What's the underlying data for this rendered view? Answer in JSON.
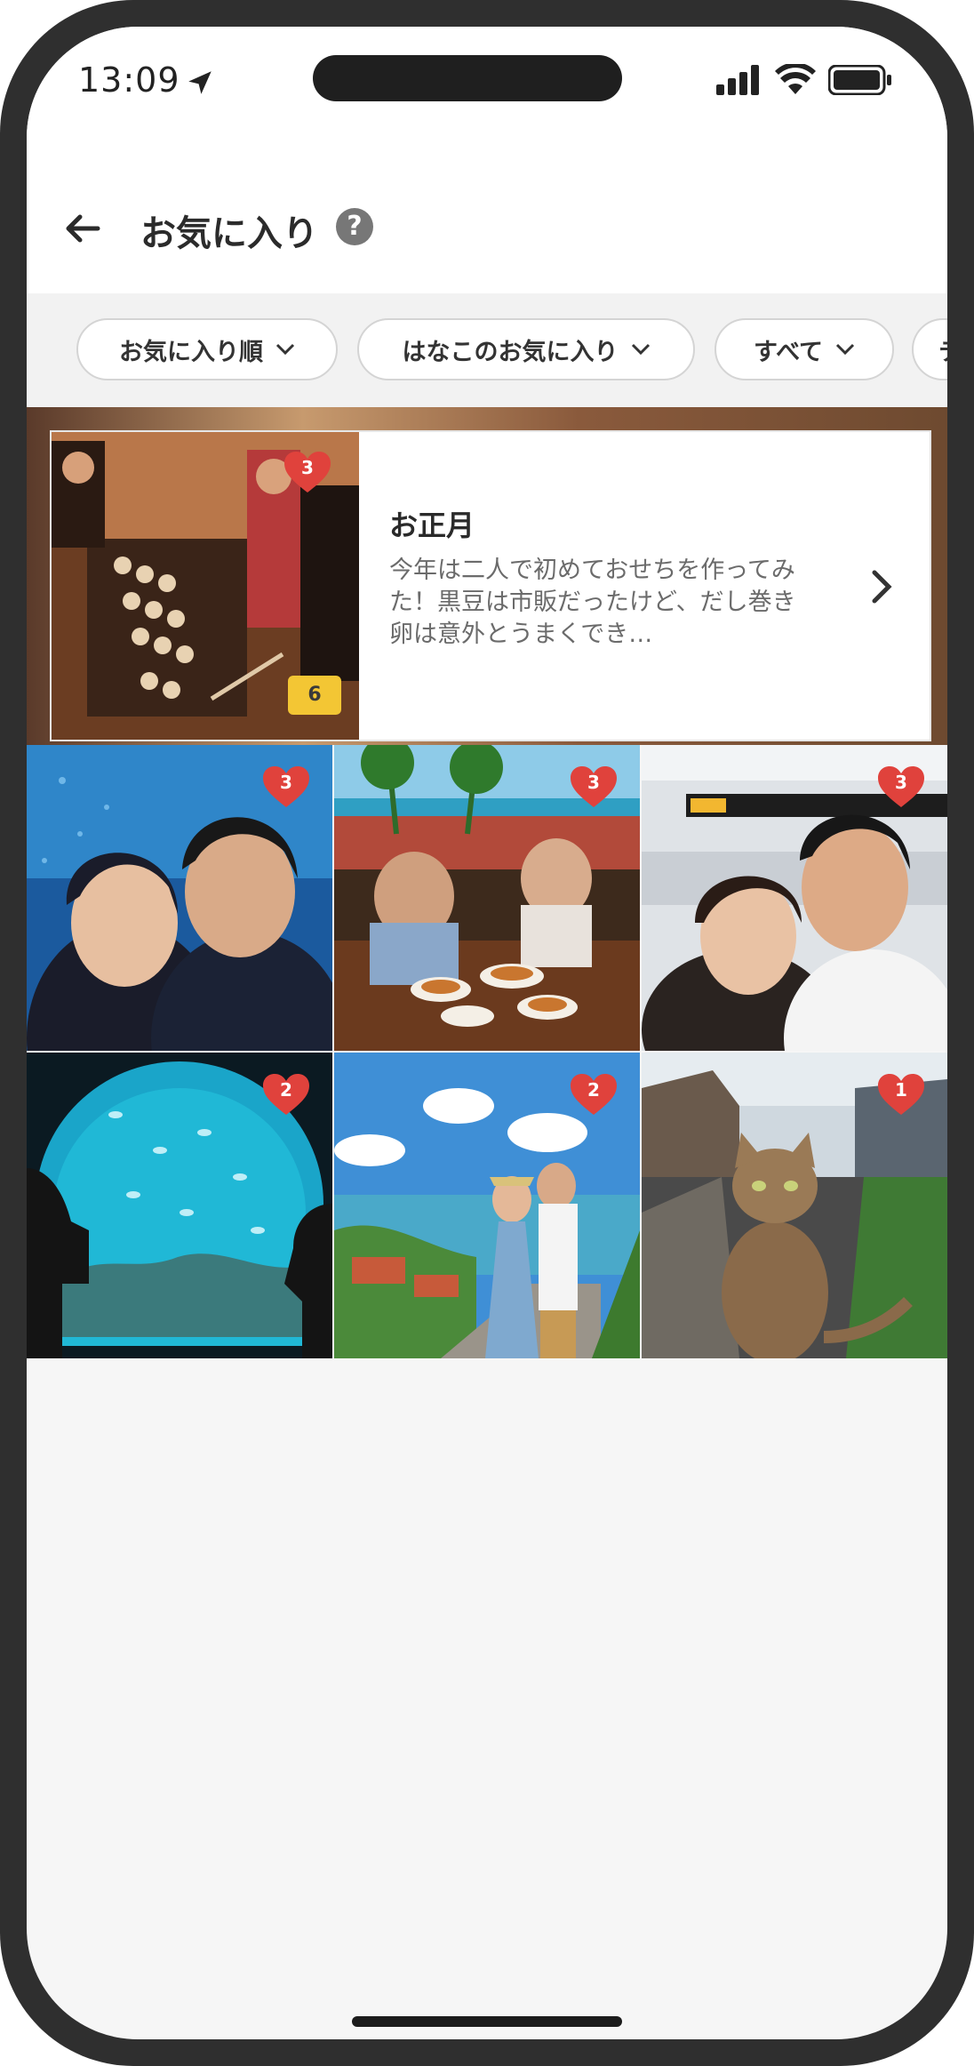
{
  "status": {
    "time": "13:09"
  },
  "header": {
    "title": "お気に入り",
    "help": "?"
  },
  "filters": [
    {
      "label": "お気に入り順"
    },
    {
      "label": "はなこのお気に入り"
    },
    {
      "label": "すべて"
    },
    {
      "label": "テ"
    }
  ],
  "album": {
    "title": "お正月",
    "description": "今年は二人で初めておせちを作ってみた！黒豆は市販だったけど、だし巻き卵は意外とうまくでき…",
    "likes": "3",
    "photo_count": "6"
  },
  "photos": [
    {
      "likes": "3",
      "scene": "aquarium-selfie"
    },
    {
      "likes": "3",
      "scene": "dinner-terrace"
    },
    {
      "likes": "3",
      "scene": "airport-selfie"
    },
    {
      "likes": "2",
      "scene": "aquarium-tunnel"
    },
    {
      "likes": "2",
      "scene": "seaside-couple"
    },
    {
      "likes": "1",
      "scene": "street-cat"
    }
  ],
  "colors": {
    "accent_heart": "#e0423c",
    "badge": "#f3c634"
  }
}
